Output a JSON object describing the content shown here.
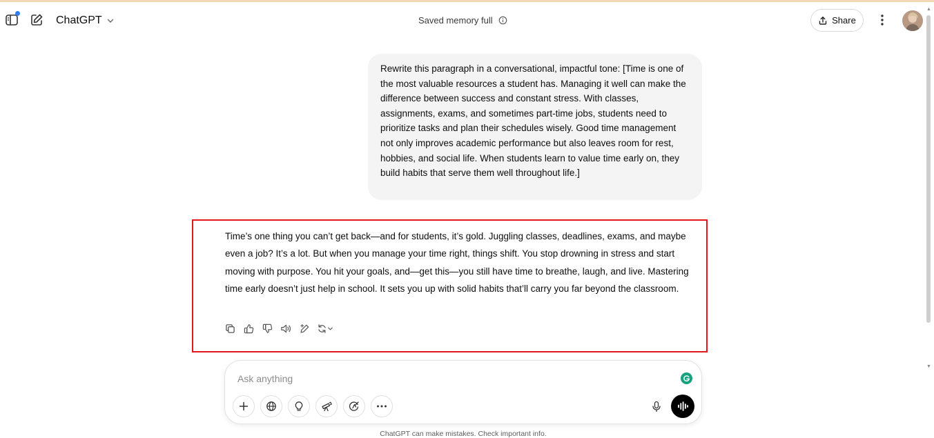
{
  "header": {
    "model_name": "ChatGPT",
    "memory_status": "Saved memory full",
    "share_label": "Share"
  },
  "conversation": {
    "user_message": "Rewrite this paragraph in a conversational, impactful tone: [Time is one of the most valuable resources a student has. Managing it well can make the difference between success and constant stress. With classes, assignments, exams, and sometimes part-time jobs, students need to prioritize tasks and plan their schedules wisely. Good time management not only improves academic performance but also leaves room for rest, hobbies, and social life. When students learn to value time early on, they build habits that serve them well throughout life.]",
    "assistant_message": "Time’s one thing you can’t get back—and for students, it’s gold. Juggling classes, deadlines, exams, and maybe even a job? It’s a lot. But when you manage your time right, things shift. You stop drowning in stress and start moving with purpose. You hit your goals, and—get this—you still have time to breathe, laugh, and live. Mastering time early doesn’t just help in school. It sets you up with solid habits that’ll carry you far beyond the classroom."
  },
  "composer": {
    "placeholder": "Ask anything"
  },
  "footer": {
    "disclaimer": "ChatGPT can make mistakes. Check important info."
  },
  "colors": {
    "highlight_border": "#e5141a",
    "user_bubble_bg": "#f4f4f4",
    "sidebar_dot": "#2f7df6",
    "grammarly": "#15a37f"
  },
  "icons": {
    "sidebar_toggle": "sidebar-icon",
    "new_chat": "edit-icon",
    "model_dropdown": "chevron-down-icon",
    "memory_info": "info-icon",
    "share": "share-icon",
    "more": "dots-vertical-icon",
    "actions": [
      "copy-icon",
      "thumbs-up-icon",
      "thumbs-down-icon",
      "read-aloud-icon",
      "edit-canvas-icon",
      "regenerate-icon"
    ],
    "tools": [
      "plus-icon",
      "globe-icon",
      "lightbulb-icon",
      "telescope-icon",
      "image-icon",
      "ellipsis-icon"
    ],
    "mic": "mic-icon",
    "voice": "voice-mode-icon"
  }
}
